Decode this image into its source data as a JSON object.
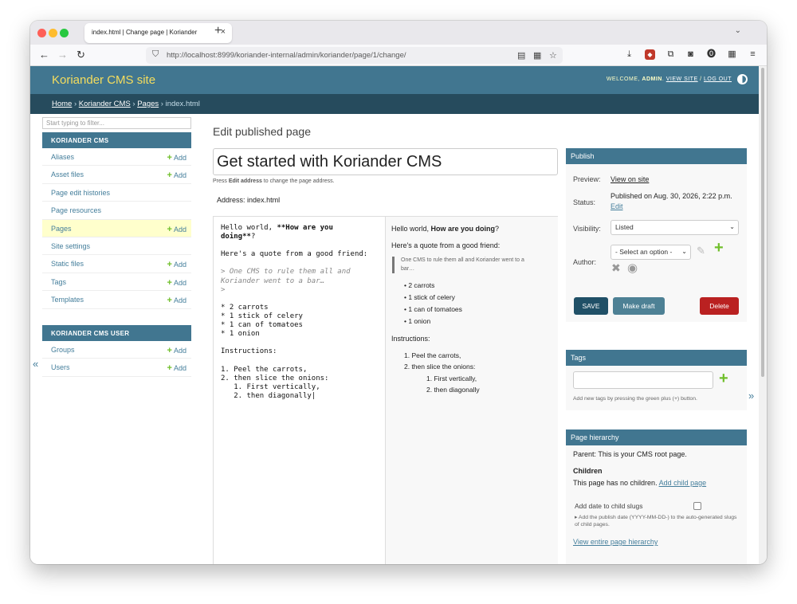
{
  "browser": {
    "tab_title": "index.html | Change page | Koriander",
    "url_host": "http://localhost",
    "url_path": ":8999/koriander-internal/admin/koriander/page/1/change/"
  },
  "header": {
    "brand": "Koriander CMS site",
    "welcome": "WELCOME, ",
    "user": "ADMIN",
    "view_site": "VIEW SITE",
    "separator": " / ",
    "logout": "LOG OUT"
  },
  "breadcrumbs": {
    "home": "Home",
    "app": "Koriander CMS",
    "model": "Pages",
    "current": "index.html",
    "sep": " › "
  },
  "sidebar": {
    "filter_placeholder": "Start typing to filter...",
    "add_label": "Add",
    "modules": [
      {
        "caption": "KORIANDER CMS",
        "items": [
          {
            "label": "Aliases"
          },
          {
            "label": "Asset files"
          },
          {
            "label": "Page edit histories"
          },
          {
            "label": "Page resources"
          },
          {
            "label": "Pages"
          },
          {
            "label": "Site settings"
          },
          {
            "label": "Static files"
          },
          {
            "label": "Tags"
          },
          {
            "label": "Templates"
          }
        ]
      },
      {
        "caption": "KORIANDER CMS USER",
        "items": [
          {
            "label": "Groups"
          },
          {
            "label": "Users"
          }
        ]
      }
    ]
  },
  "main": {
    "heading": "Edit published page",
    "title_value": "Get started with Koriander CMS",
    "help_pre": "Press ",
    "help_bold": "Edit address",
    "help_post": " to change the page address.",
    "address_label": "Address:",
    "address_value": "index.html"
  },
  "editor": {
    "md_lines": {
      "l1a": "Hello world, ",
      "l1b": "**How are you",
      "l2a": "doing**",
      "l2b": "?",
      "l3": "Here's a quote from a good friend:",
      "q1": "> One CMS to rule them all and",
      "q2": "Koriander went to a bar…",
      "q3": ">",
      "c1": "* 2 carrots",
      "c2": "* 1 stick of celery",
      "c3": "* 1 can of tomatoes",
      "c4": "* 1 onion",
      "i0": "Instructions:",
      "i1": "1. Peel the carrots,",
      "i2": "2. then slice the onions:",
      "i3": "   1. First vertically,",
      "i4": "   2. then diagonally"
    },
    "preview": {
      "p1a": "Hello world, ",
      "p1b": "How are you doing",
      "p1c": "?",
      "p2": "Here's a quote from a good friend:",
      "quote": "One CMS to rule them all and Koriander went to a bar…",
      "items": [
        "2 carrots",
        "1 stick of celery",
        "1 can of tomatoes",
        "1 onion"
      ],
      "instructions": "Instructions:",
      "s1": "1. Peel the carrots,",
      "s2": "2. then slice the onions:",
      "s3": "1. First vertically,",
      "s4": "2. then diagonally"
    }
  },
  "publish": {
    "caption": "Publish",
    "preview_label": "Preview:",
    "preview_link": "View on site",
    "status_label": "Status:",
    "status_value": "Published on Aug. 30, 2026, 2:22 p.m.",
    "status_edit": "Edit",
    "visibility_label": "Visibility:",
    "visibility_value": "Listed",
    "author_label": "Author:",
    "author_placeholder": "- Select an option -",
    "save": "SAVE",
    "make_draft": "Make draft",
    "delete": "Delete"
  },
  "tags": {
    "caption": "Tags",
    "help": "Add new tags by pressing the green plus (+) button."
  },
  "hierarchy": {
    "caption": "Page hierarchy",
    "parent_label": "Parent:",
    "parent_value": " This is your CMS root page.",
    "children_heading": "Children",
    "children_text": "This page has no children. ",
    "add_child": "Add child page",
    "date_label": "Add date to child slugs",
    "date_help": "▸ Add the publish date (YYYY-MM-DD-) to the auto-generated slugs of child pages.",
    "view_all": "View entire page hierarchy"
  },
  "colors": {
    "header": "#417690",
    "breadcrumbs": "#264b5d",
    "brand": "#f5dd5d",
    "link": "#447e9b",
    "add_green": "#70bf2b",
    "delete_red": "#ba2121",
    "current_row": "#ffffcc"
  }
}
